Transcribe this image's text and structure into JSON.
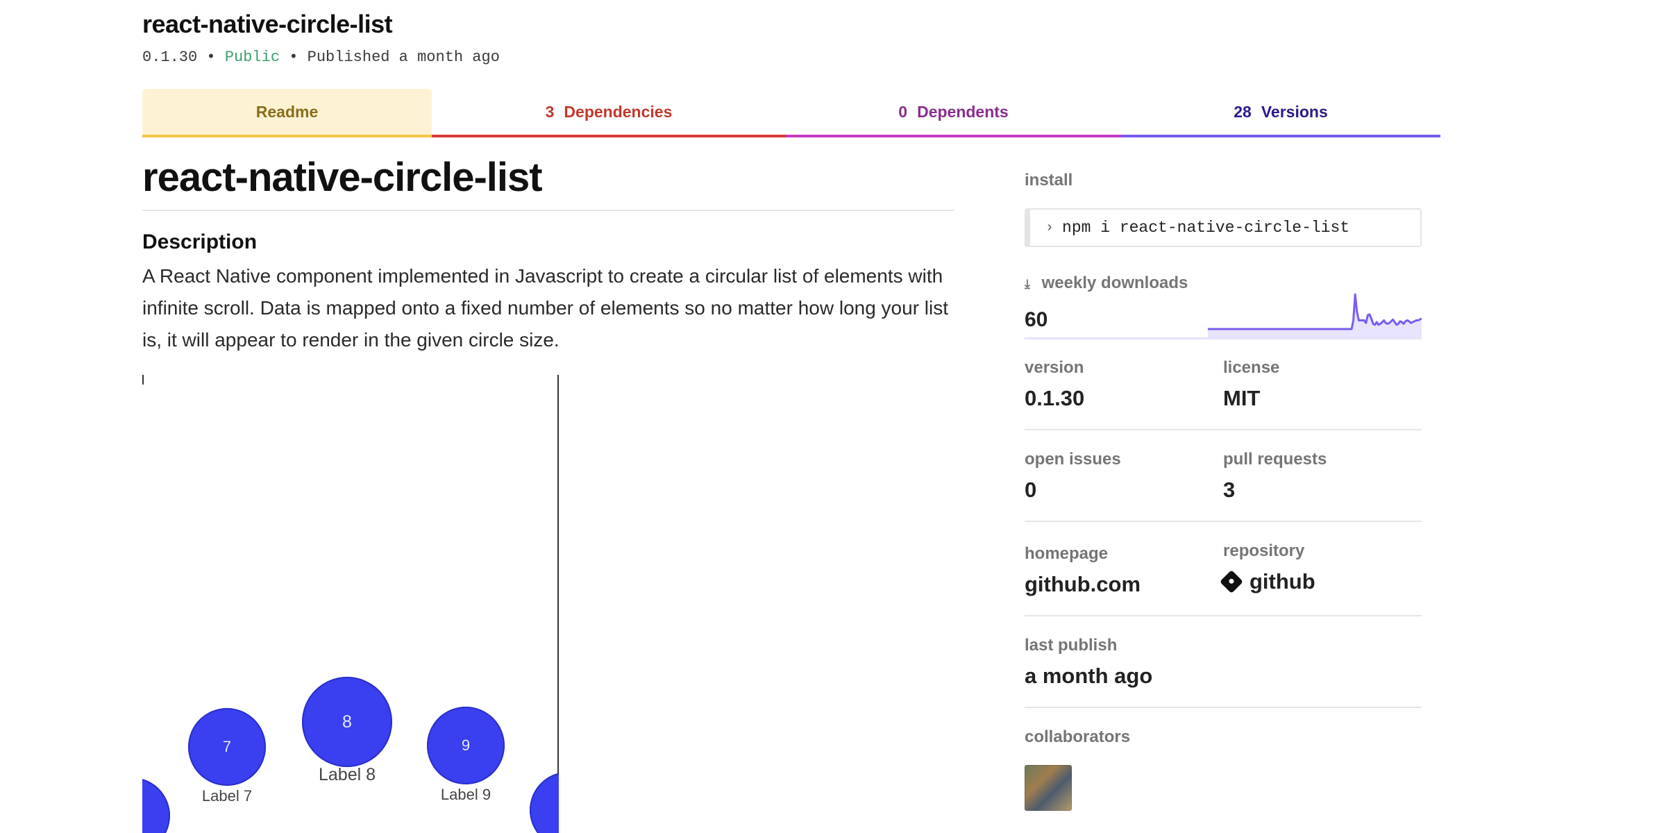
{
  "package": {
    "name": "react-native-circle-list",
    "version": "0.1.30",
    "visibility": "Public",
    "published": "Published a month ago",
    "separator": "•"
  },
  "tabs": [
    {
      "label": "Readme",
      "count": ""
    },
    {
      "label": "Dependencies",
      "count": "3"
    },
    {
      "label": "Dependents",
      "count": "0"
    },
    {
      "label": "Versions",
      "count": "28"
    }
  ],
  "readme": {
    "title": "react-native-circle-list",
    "description_heading": "Description",
    "description": "A React Native component implemented in Javascript to create a circular list of elements with infinite scroll. Data is mapped onto a fixed number of elements so no matter how long your list is, it will appear to render in the given circle size.",
    "demo_items": [
      {
        "number": "7",
        "label": "Label 7"
      },
      {
        "number": "8",
        "label": "Label 8"
      },
      {
        "number": "9",
        "label": "Label 9"
      }
    ]
  },
  "sidebar": {
    "install_label": "install",
    "install_command": "npm i react-native-circle-list",
    "weekly_downloads_label": "weekly downloads",
    "weekly_downloads": "60",
    "version_label": "version",
    "version": "0.1.30",
    "license_label": "license",
    "license": "MIT",
    "open_issues_label": "open issues",
    "open_issues": "0",
    "pull_requests_label": "pull requests",
    "pull_requests": "3",
    "homepage_label": "homepage",
    "homepage": "github.com",
    "repository_label": "repository",
    "repository": "github",
    "last_publish_label": "last publish",
    "last_publish": "a month ago",
    "collaborators_label": "collaborators"
  },
  "colors": {
    "accent_sparkline": "#7a5cf0",
    "public": "#3c9e6c",
    "demo_circle": "#3a3ff0"
  },
  "icons": {
    "download": "download-arrow-icon",
    "terminal": "chevron-right-icon",
    "repository": "git-diamond-icon"
  },
  "downloads_trend": [
    0,
    0,
    0,
    0,
    0,
    0,
    0,
    0,
    0,
    0,
    0,
    0,
    0,
    0,
    0,
    0,
    0,
    0,
    0,
    0,
    0,
    0,
    0,
    0,
    0,
    0,
    0,
    0,
    0,
    0,
    0,
    0,
    0,
    0,
    0,
    0,
    0,
    0,
    0,
    0,
    0,
    0,
    0,
    0,
    0,
    0,
    0,
    0,
    0,
    0,
    0,
    0,
    0,
    0,
    0,
    0,
    0,
    0,
    0,
    0,
    0,
    0,
    0,
    0,
    0,
    0,
    0,
    0,
    0,
    0,
    0,
    0,
    0,
    0,
    0,
    0,
    0,
    0,
    0,
    0,
    0,
    1,
    4,
    2,
    1,
    1,
    1,
    1,
    0.7,
    1.6,
    1.7,
    1.2,
    0.6,
    0.5,
    0.8,
    0.5,
    0.6,
    0.8,
    1.0,
    0.7,
    0.6,
    0.7,
    0.9,
    1.1,
    0.8,
    0.5,
    0.6,
    0.9,
    0.8,
    0.6,
    0.9,
    1.0,
    0.9,
    0.7,
    0.8,
    0.9,
    1.0,
    1.0,
    1.1,
    1.2
  ]
}
